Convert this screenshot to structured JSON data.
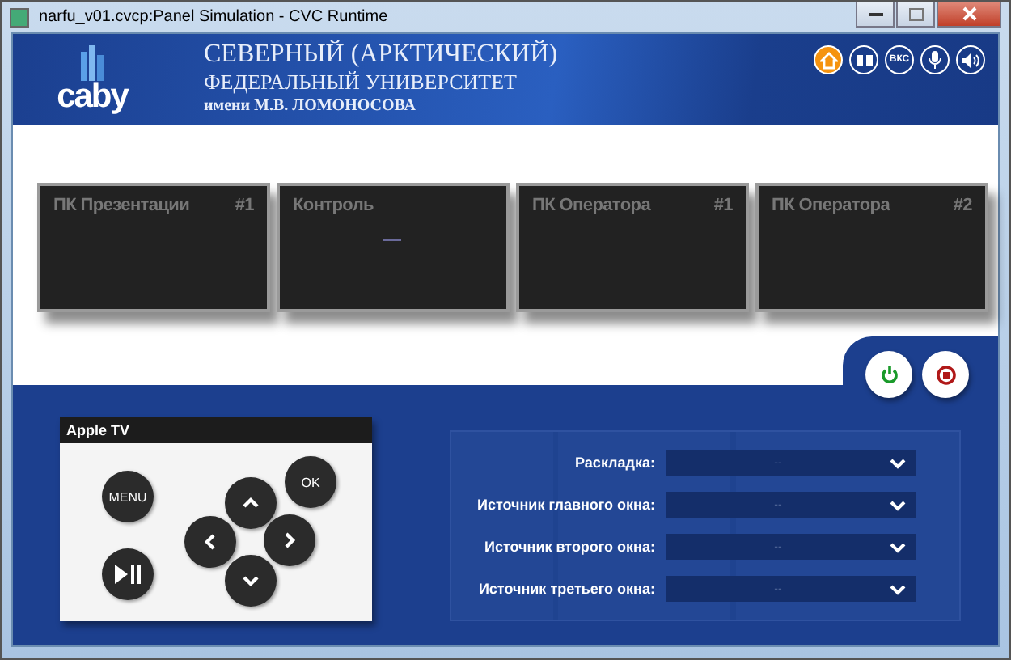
{
  "window": {
    "title": "narfu_v01.cvcp:Panel Simulation - CVC Runtime"
  },
  "header": {
    "logo": "caby",
    "title_lines": [
      "СЕВЕРНЫЙ (АРКТИЧЕСКИЙ)",
      "ФЕДЕРАЛЬНЫЙ УНИВЕРСИТЕТ",
      "имени М.В. ЛОМОНОСОВА"
    ],
    "toolbar": [
      {
        "kind": "home",
        "selected": true
      },
      {
        "kind": "presentation",
        "selected": false
      },
      {
        "kind": "text",
        "label": "ВКС",
        "selected": false
      },
      {
        "kind": "mic",
        "selected": false
      },
      {
        "kind": "speaker",
        "selected": false
      }
    ]
  },
  "displays": [
    {
      "name": "ПК Презентации",
      "number": "#1",
      "signal": false
    },
    {
      "name": "Контроль",
      "signal": true
    },
    {
      "name": "ПК Оператора",
      "number": "#1",
      "signal": false
    },
    {
      "name": "ПК Оператора",
      "number": "#2",
      "signal": false
    }
  ],
  "power": [
    {
      "kind": "on"
    },
    {
      "kind": "off"
    }
  ],
  "remote": {
    "title": "Apple TV",
    "buttons": [
      {
        "kind": "menu",
        "label": "MENU"
      },
      {
        "kind": "play_pause"
      },
      {
        "kind": "up"
      },
      {
        "kind": "ok",
        "label": "OK"
      },
      {
        "kind": "left"
      },
      {
        "kind": "right"
      },
      {
        "kind": "down"
      }
    ]
  },
  "settings": [
    {
      "label": "Раскладка:",
      "value": "--"
    },
    {
      "label": "Источник главного окна:",
      "value": "--"
    },
    {
      "label": "Источник второго окна:",
      "value": "--"
    },
    {
      "label": "Источник третьего окна:",
      "value": "--"
    }
  ]
}
